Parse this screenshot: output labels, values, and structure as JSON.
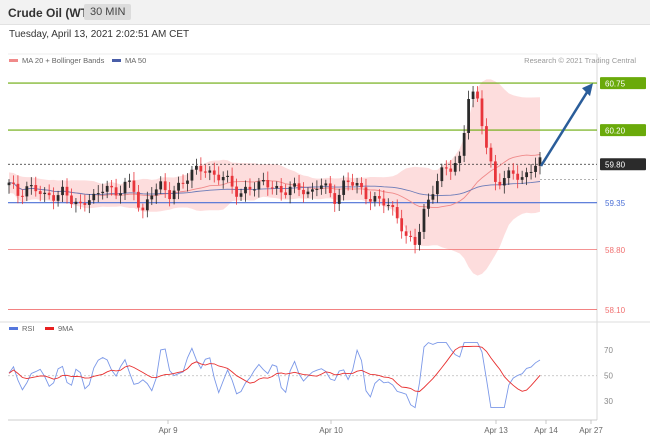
{
  "header": {
    "title": "Crude Oil (WTI)",
    "timeframe": "30 MIN"
  },
  "datetime": "Tuesday, April 13, 2021 2:02:51 AM CET",
  "legend": {
    "bollinger": "MA 20 + Bollinger Bands",
    "ma50": "MA 50",
    "credit": "Research © 2021 Trading Central"
  },
  "rsi_legend": {
    "rsi": "RSI",
    "ma9": "9MA"
  },
  "colors": {
    "up": "#2a2a2a",
    "down": "#e8353b",
    "bbFill": "#fdd7d7",
    "ma20": "#f08a8a",
    "ma50": "#6b7bb8",
    "green": "#6aaa0a",
    "blue": "#4a6fd6",
    "red": "#f07070",
    "rsi": "#7b98e8",
    "rsima": "#e83030",
    "arrow": "#2a5d9a",
    "current": "#2b2b2b"
  },
  "chart_data": [
    {
      "type": "candlestick",
      "title": "Crude Oil (WTI)",
      "timeframe": "30 MIN",
      "x_labels": [
        "Apr 9",
        "Apr 10",
        "Apr 13",
        "Apr 14",
        "Apr 27"
      ],
      "ylim": [
        58.0,
        60.95
      ],
      "price_levels": [
        {
          "value": 60.75,
          "label": "60.75",
          "color": "green"
        },
        {
          "value": 60.2,
          "label": "60.20",
          "color": "green"
        },
        {
          "value": 59.8,
          "label": "59.80",
          "color": "current"
        },
        {
          "value": 59.35,
          "label": "59.35",
          "color": "blue"
        },
        {
          "value": 58.8,
          "label": "58.80",
          "color": "red"
        },
        {
          "value": 58.1,
          "label": "58.10",
          "color": "red"
        }
      ],
      "projection": {
        "from": 59.78,
        "to": 60.75
      },
      "close_anchors": [
        59.55,
        59.45,
        59.55,
        59.5,
        59.4,
        59.45,
        59.5,
        59.35,
        59.3,
        59.45,
        59.4,
        59.55,
        59.45,
        59.6,
        59.5,
        59.2,
        59.5,
        59.55,
        59.4,
        59.55,
        59.65,
        59.7,
        59.75,
        59.7,
        59.65,
        59.55,
        59.45,
        59.55,
        59.5,
        59.6,
        59.55,
        59.45,
        59.5,
        59.55,
        59.45,
        59.55,
        59.5,
        59.4,
        59.6,
        59.55,
        59.5,
        59.4,
        59.35,
        59.3,
        59.2,
        58.9,
        58.85,
        59.3,
        59.55,
        59.7,
        59.75,
        59.9,
        60.65,
        60.5,
        60.0,
        59.6,
        59.6,
        59.7,
        59.65,
        59.75,
        59.8
      ],
      "series": [
        "MA 20 + Bollinger Bands",
        "MA 50"
      ]
    },
    {
      "type": "line",
      "title": "RSI",
      "series": [
        "RSI",
        "9MA"
      ],
      "yticks": [
        70,
        50,
        30
      ],
      "ylim": [
        20,
        78
      ]
    }
  ]
}
